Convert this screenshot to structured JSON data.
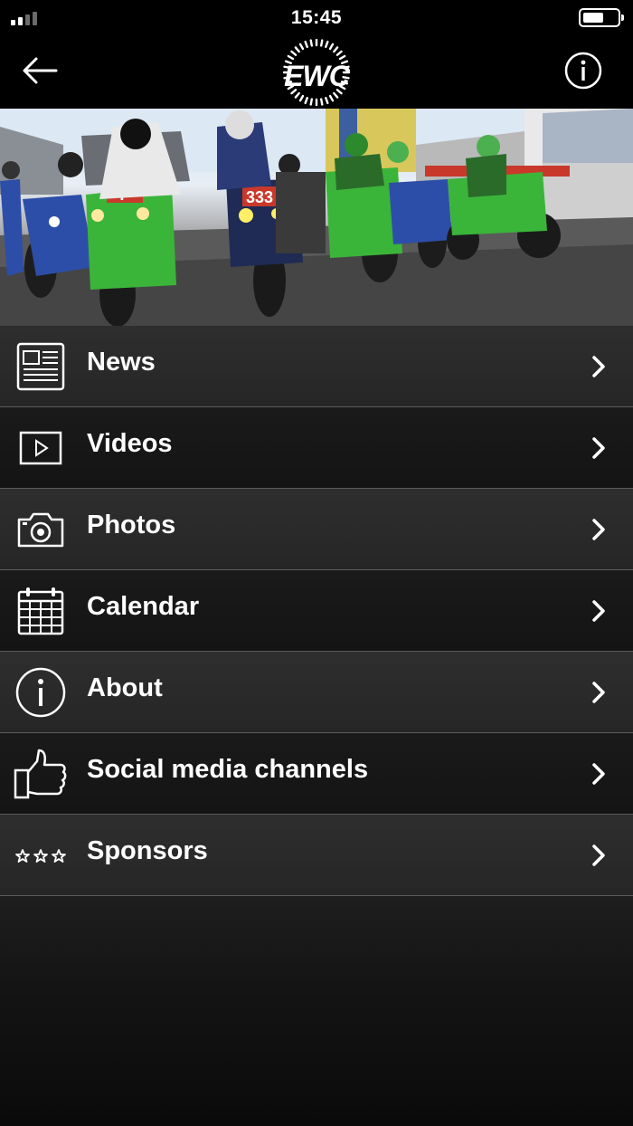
{
  "status_bar": {
    "time": "15:45",
    "icons": [
      "signal-icon",
      "battery-icon"
    ]
  },
  "nav_bar": {
    "logo_text": "EWC",
    "back_icon": "arrow-left-icon",
    "info_icon": "info-circle-icon"
  },
  "hero": {
    "image": "motorcycle-grid-photo",
    "bike_number_1": "4",
    "bike_number_2": "333"
  },
  "menu": {
    "items": [
      {
        "label": "News",
        "icon": "newspaper-icon"
      },
      {
        "label": "Videos",
        "icon": "video-play-icon"
      },
      {
        "label": "Photos",
        "icon": "camera-icon"
      },
      {
        "label": "Calendar",
        "icon": "calendar-icon"
      },
      {
        "label": "About",
        "icon": "info-circle-icon"
      },
      {
        "label": "Social media channels",
        "icon": "thumbs-up-icon"
      },
      {
        "label": "Sponsors",
        "icon": "stars-icon"
      }
    ],
    "chevron_icon": "chevron-right-icon"
  },
  "colors": {
    "background": "#000000",
    "menu_row_light": "#2a2a2a",
    "menu_row_dark": "#161616",
    "text": "#ffffff",
    "bike_green": "#3bb43a",
    "bike_blue": "#2d4ea8"
  }
}
